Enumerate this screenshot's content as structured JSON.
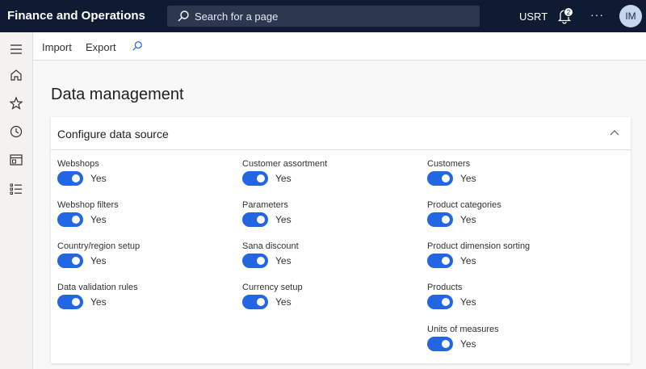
{
  "header": {
    "app_title": "Finance and Operations",
    "search_placeholder": "Search for a page",
    "company": "USRT",
    "notification_count": "2",
    "more": "···",
    "avatar_initials": "IM"
  },
  "actionbar": {
    "import_label": "Import",
    "export_label": "Export"
  },
  "page": {
    "title": "Data management"
  },
  "section": {
    "title": "Configure data source",
    "col1": [
      {
        "label": "Webshops",
        "value": "Yes"
      },
      {
        "label": "Webshop filters",
        "value": "Yes"
      },
      {
        "label": "Country/region setup",
        "value": "Yes"
      },
      {
        "label": "Data validation rules",
        "value": "Yes"
      }
    ],
    "col2": [
      {
        "label": "Customer assortment",
        "value": "Yes"
      },
      {
        "label": "Parameters",
        "value": "Yes"
      },
      {
        "label": "Sana discount",
        "value": "Yes"
      },
      {
        "label": "Currency setup",
        "value": "Yes"
      }
    ],
    "col3": [
      {
        "label": "Customers",
        "value": "Yes"
      },
      {
        "label": "Product categories",
        "value": "Yes"
      },
      {
        "label": "Product dimension sorting",
        "value": "Yes"
      },
      {
        "label": "Products",
        "value": "Yes"
      },
      {
        "label": "Units of measures",
        "value": "Yes"
      }
    ]
  },
  "colors": {
    "topbar": "#0e1b33",
    "toggle_on": "#2266e3"
  }
}
